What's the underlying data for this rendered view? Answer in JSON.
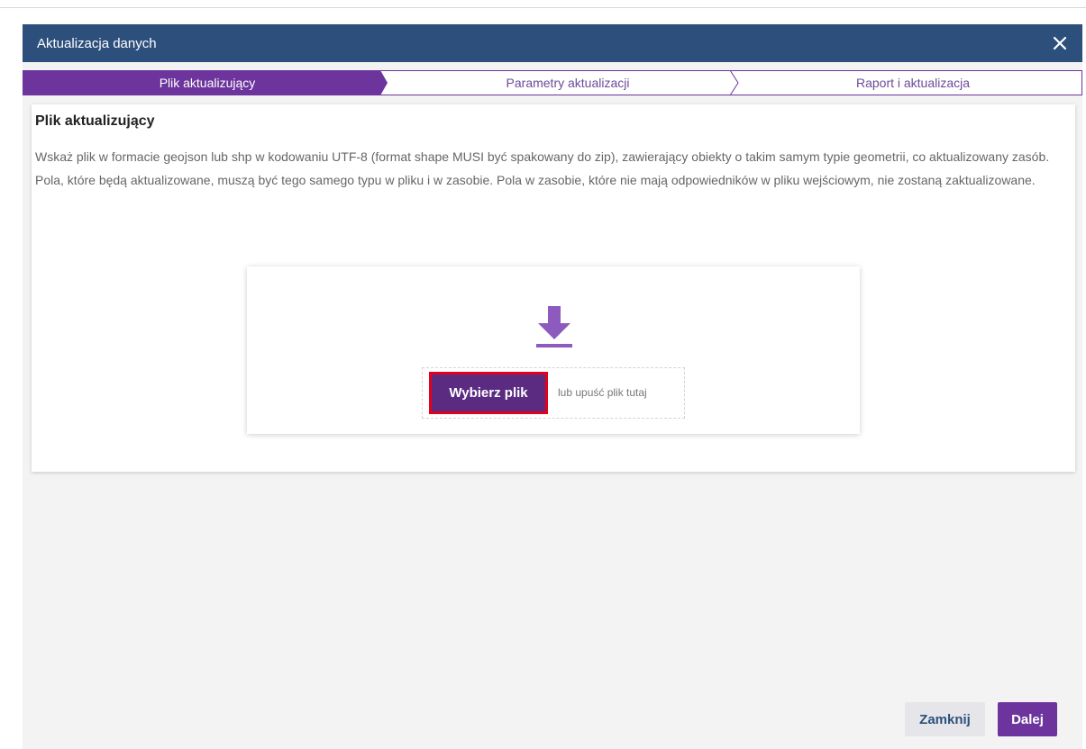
{
  "dialog": {
    "title": "Aktualizacja danych",
    "close_icon": "close-icon"
  },
  "steps": [
    {
      "label": "Plik aktualizujący",
      "active": true
    },
    {
      "label": "Parametry aktualizacji",
      "active": false
    },
    {
      "label": "Raport i aktualizacja",
      "active": false
    }
  ],
  "panel": {
    "title": "Plik aktualizujący",
    "description": "Wskaż plik w formacie geojson lub shp w kodowaniu UTF-8 (format shape MUSI być spakowany do zip), zawierający obiekty o takim samym typie geometrii, co aktualizowany zasób. Pola, które będą aktualizowane, muszą być tego samego typu w pliku i w zasobie. Pola w zasobie, które nie mają odpowiedników w pliku wejściowym, nie zostaną zaktualizowane."
  },
  "upload": {
    "icon": "download-icon",
    "choose_label": "Wybierz plik",
    "drop_hint": "lub upuść plik tutaj"
  },
  "footer": {
    "close_label": "Zamknij",
    "next_label": "Dalej"
  },
  "colors": {
    "titlebar": "#2d4f7c",
    "accent": "#6c349c",
    "highlight_border": "#e3001b"
  }
}
